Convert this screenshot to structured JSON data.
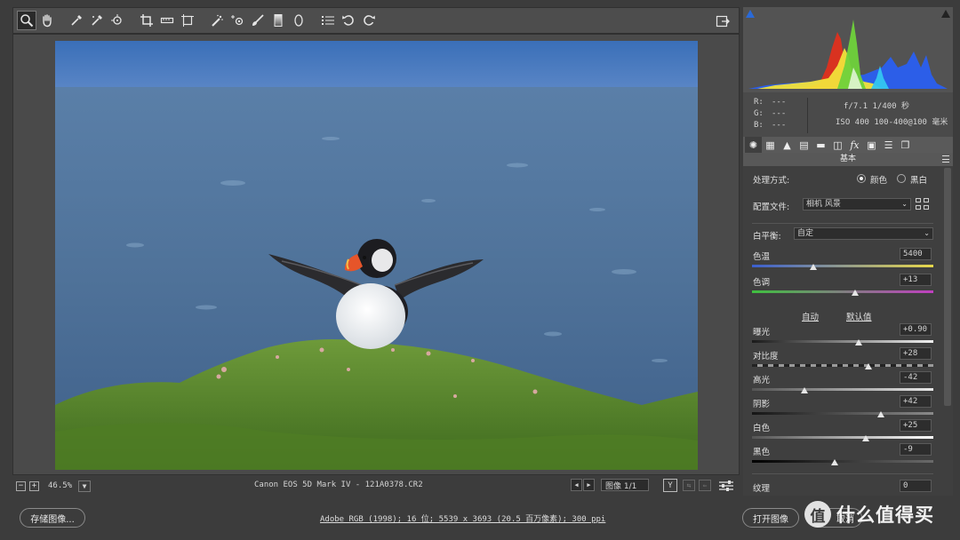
{
  "toolbar": {
    "tools": [
      "zoom-tool-icon",
      "hand-tool-icon",
      "white-balance-tool-icon",
      "color-sampler-tool-icon",
      "targeted-adjustment-tool-icon",
      "crop-tool-icon",
      "straighten-tool-icon",
      "transform-tool-icon",
      "spot-removal-tool-icon",
      "red-eye-tool-icon",
      "adjustment-brush-icon",
      "graduated-filter-icon",
      "radial-filter-icon",
      "presets-list-icon",
      "rotate-ccw-icon",
      "rotate-cw-icon"
    ],
    "fullscreen_icon": "toggle-fullscreen-icon"
  },
  "status": {
    "zoom_out": "−",
    "zoom_in": "+",
    "zoom_value": "46.5%",
    "filename": "Canon EOS 5D Mark IV -  121A0378.CR2",
    "image_counter": "图像 1/1",
    "y_label": "Y"
  },
  "footer": {
    "save_button": "存储图像...",
    "workflow_info": "Adobe RGB (1998); 16 位; 5539 x 3693 (20.5 百万像素); 300 ppi",
    "open_button": "打开图像",
    "cancel_button": "取消",
    "watermark_logo": "值",
    "watermark_text": "什么值得买"
  },
  "histogram": {
    "colors": {
      "red": "#e0301e",
      "yellow": "#f2e23a",
      "green": "#6fd23b",
      "blue": "#2a5ff0",
      "cyan": "#34c6f0",
      "white": "#ffffff"
    }
  },
  "readout": {
    "r_label": "R:",
    "r_value": "---",
    "g_label": "G:",
    "g_value": "---",
    "b_label": "B:",
    "b_value": "---",
    "exposure": "f/7.1  1/400 秒",
    "iso_lens": "ISO 400  100-400@100 毫米"
  },
  "panel_tabs": [
    "basic-icon",
    "tone-curve-icon",
    "detail-icon",
    "hsl-icon",
    "split-toning-icon",
    "lens-corrections-icon",
    "effects-icon",
    "camera-calibration-icon",
    "presets-icon",
    "snapshots-icon"
  ],
  "basic": {
    "section_title": "基本",
    "treatment_label": "处理方式:",
    "color_option": "颜色",
    "bw_option": "黑白",
    "profile_label": "配置文件:",
    "profile_value": "相机 风景",
    "wb_label": "白平衡:",
    "wb_value": "自定",
    "temp_label": "色温",
    "temp_value": "5400",
    "tint_label": "色调",
    "tint_value": "+13",
    "auto_link": "自动",
    "default_link": "默认值",
    "exposure_label": "曝光",
    "exposure_value": "+0.90",
    "contrast_label": "对比度",
    "contrast_value": "+28",
    "highlights_label": "高光",
    "highlights_value": "-42",
    "shadows_label": "阴影",
    "shadows_value": "+42",
    "whites_label": "白色",
    "whites_value": "+25",
    "blacks_label": "黑色",
    "blacks_value": "-9",
    "texture_label": "纹理",
    "texture_value": "0"
  },
  "slider_levels": {
    "temp": 0.34,
    "tint": 0.57,
    "exposure": 0.59,
    "contrast": 0.64,
    "highlights": 0.29,
    "shadows": 0.71,
    "whites": 0.625,
    "blacks": 0.455
  }
}
